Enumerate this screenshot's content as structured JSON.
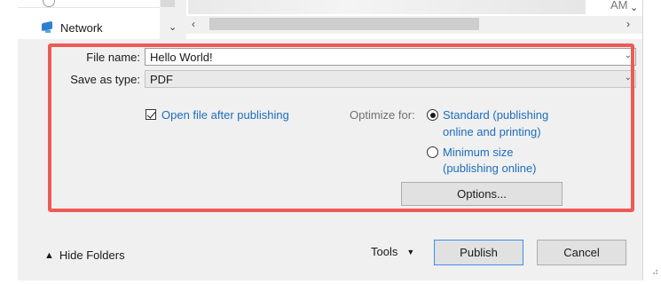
{
  "nav": {
    "network_label": "Network"
  },
  "file_list": {
    "partial_time": "AM"
  },
  "form": {
    "file_name_label": "File name:",
    "file_name_value": "Hello World!",
    "save_type_label": "Save as type:",
    "save_type_value": "PDF"
  },
  "options": {
    "open_after_label": "Open file after publishing",
    "open_after_checked": true,
    "optimize_label": "Optimize for:",
    "standard_line1": "Standard (publishing",
    "standard_line2": "online and printing)",
    "standard_selected": true,
    "minimum_line1": "Minimum size",
    "minimum_line2": "(publishing online)",
    "options_button": "Options..."
  },
  "footer": {
    "hide_folders": "Hide Folders",
    "tools": "Tools",
    "publish": "Publish",
    "cancel": "Cancel"
  },
  "colors": {
    "highlight": "#ee5a56",
    "link_blue": "#1c6ebd",
    "dialog_bg": "#f0f0f0"
  }
}
